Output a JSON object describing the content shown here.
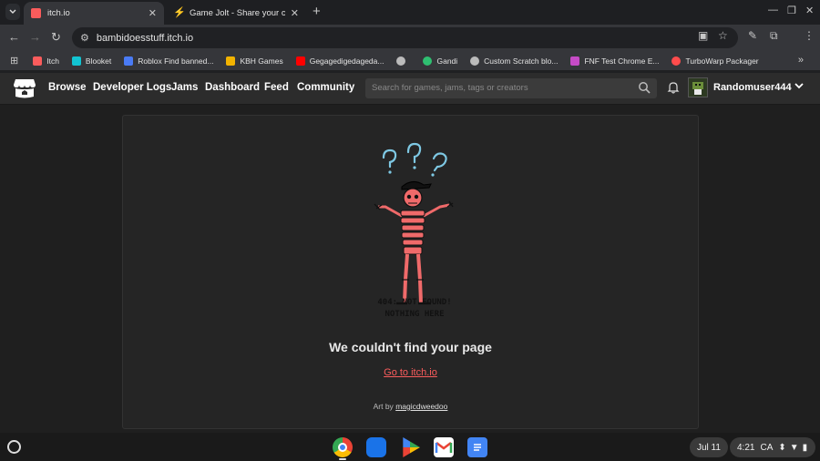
{
  "browser": {
    "tabs": [
      {
        "title": "itch.io",
        "active": true,
        "favicon_color": "#fa5c5c"
      },
      {
        "title": "Game Jolt - Share your creation",
        "active": false,
        "favicon_color": "#cccccc"
      }
    ],
    "url": "bambidoesstuff.itch.io",
    "bookmarks": [
      {
        "label": "Itch",
        "color": "#fa5c5c"
      },
      {
        "label": "Blooket",
        "color": "#12c4d2"
      },
      {
        "label": "Roblox Find banned...",
        "color": "#4a7bf5"
      },
      {
        "label": "KBH Games",
        "color": "#f2b300"
      },
      {
        "label": "Gegagedigedageda...",
        "color": "#ff0000"
      },
      {
        "label": "",
        "color": "#bbbbbb"
      },
      {
        "label": "Gandi",
        "color": "#2fbf71"
      },
      {
        "label": "Custom Scratch blo...",
        "color": "#bbbbbb"
      },
      {
        "label": "FNF Test Chrome E...",
        "color": "#c64bc6"
      },
      {
        "label": "TurboWarp Packager",
        "color": "#ff4c4c"
      }
    ]
  },
  "itch": {
    "nav": [
      "Browse",
      "Developer Logs",
      "Jams",
      "Dashboard",
      "Feed",
      "Community"
    ],
    "search_placeholder": "Search for games, jams, tags or creators",
    "username": "Randomuser444"
  },
  "error": {
    "illustration_caption_1": "404: NOT FOUND!",
    "illustration_caption_2": "NOTHING HERE",
    "heading": "We couldn't find your page",
    "link": "Go to itch.io",
    "credit_prefix": "Art by",
    "credit_author": "magicdweedoo"
  },
  "shelf": {
    "date": "Jul 11",
    "time": "4:21",
    "region": "CA"
  },
  "colors": {
    "itch_red": "#fa5c5c",
    "skeleton": "#f06a6a",
    "question": "#7ec8e3"
  }
}
